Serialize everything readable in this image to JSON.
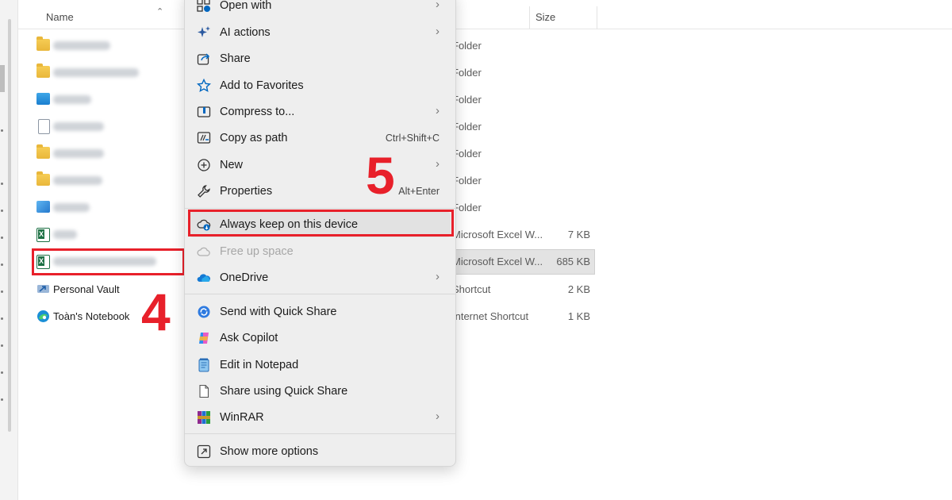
{
  "header": {
    "name_label": "Name",
    "size_label": "Size",
    "sort_icon": "chevron-up-icon"
  },
  "files": [
    {
      "icon": "folder-icon",
      "type": "Folder",
      "size": ""
    },
    {
      "icon": "folder-icon",
      "type": "Folder",
      "size": ""
    },
    {
      "icon": "desktop-icon",
      "type": "Folder",
      "size": ""
    },
    {
      "icon": "document-icon",
      "type": "Folder",
      "size": ""
    },
    {
      "icon": "folder-icon",
      "type": "Folder",
      "size": ""
    },
    {
      "icon": "folder-icon",
      "type": "Folder",
      "size": ""
    },
    {
      "icon": "picture-icon",
      "type": "Folder",
      "size": ""
    },
    {
      "icon": "excel-icon",
      "type": "Microsoft Excel W...",
      "size": "7 KB"
    },
    {
      "icon": "excel-icon",
      "type": "Microsoft Excel W...",
      "size": "685 KB"
    },
    {
      "icon": "shortcut-icon",
      "name": "Personal Vault",
      "type": "Shortcut",
      "size": "2 KB"
    },
    {
      "icon": "edge-icon",
      "name": "Toàn's Notebook",
      "type": "Internet Shortcut",
      "size": "1 KB"
    }
  ],
  "annotations": {
    "step4": "4",
    "step5": "5"
  },
  "menu": {
    "items": [
      {
        "label": "Open with",
        "icon": "open-with-icon",
        "submenu": true
      },
      {
        "label": "AI actions",
        "icon": "sparkle-icon",
        "submenu": true
      },
      {
        "label": "Share",
        "icon": "share-icon"
      },
      {
        "label": "Add to Favorites",
        "icon": "star-icon"
      },
      {
        "label": "Compress to...",
        "icon": "zip-icon",
        "submenu": true
      },
      {
        "label": "Copy as path",
        "icon": "copy-path-icon",
        "shortcut": "Ctrl+Shift+C"
      },
      {
        "label": "New",
        "icon": "plus-circle-icon",
        "submenu": true
      },
      {
        "label": "Properties",
        "icon": "wrench-icon",
        "shortcut": "Alt+Enter"
      },
      {
        "label": "Always keep on this device",
        "icon": "cloud-download-icon"
      },
      {
        "label": "Free up space",
        "icon": "cloud-icon",
        "disabled": true
      },
      {
        "label": "OneDrive",
        "icon": "onedrive-icon",
        "submenu": true
      },
      {
        "label": "Send with Quick Share",
        "icon": "quick-share-icon"
      },
      {
        "label": "Ask Copilot",
        "icon": "copilot-icon"
      },
      {
        "label": "Edit in Notepad",
        "icon": "notepad-icon"
      },
      {
        "label": "Share using Quick Share",
        "icon": "blank-file-icon"
      },
      {
        "label": "WinRAR",
        "icon": "winrar-icon",
        "submenu": true
      },
      {
        "label": "Show more options",
        "icon": "more-options-icon"
      }
    ]
  },
  "colors": {
    "annotation": "#e8202a",
    "accent": "#0067c0",
    "menu_bg": "#eeeeee"
  }
}
